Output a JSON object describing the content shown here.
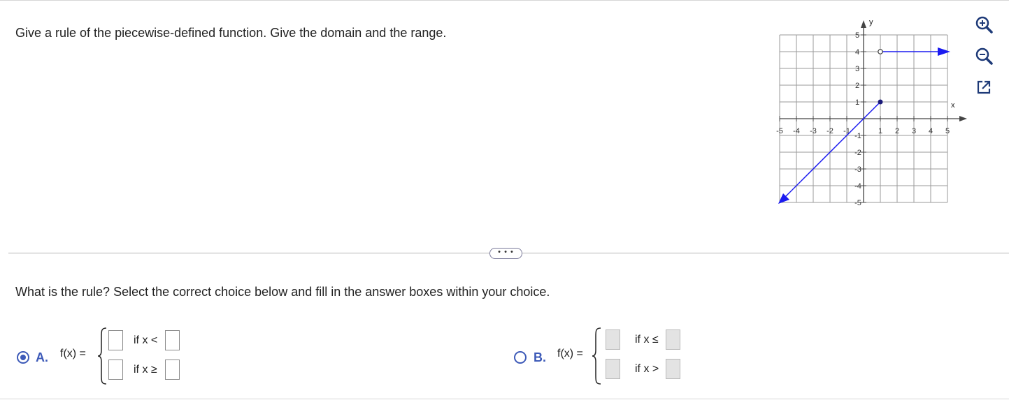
{
  "question": "Give a rule of the piecewise-defined function. Give the domain and the range.",
  "graph": {
    "x_label": "x",
    "y_label": "y",
    "x_ticks": [
      "-5",
      "-4",
      "-3",
      "-2",
      "-1",
      "1",
      "2",
      "3",
      "4",
      "5"
    ],
    "y_ticks_pos": [
      "5",
      "4",
      "3",
      "2",
      "1"
    ],
    "y_ticks_neg": [
      "-1",
      "-2",
      "-3",
      "-4",
      "-5"
    ],
    "line_color": "#1b1bf0",
    "segments": [
      {
        "from": [
          -5,
          -5
        ],
        "to": [
          1,
          1
        ],
        "arrow_at_start": true,
        "end": "closed"
      },
      {
        "from": [
          1,
          4
        ],
        "to": [
          5,
          4
        ],
        "start": "open",
        "arrow_at_end": true
      }
    ]
  },
  "tools": [
    "zoom-in-icon",
    "zoom-out-icon",
    "pop-out-icon"
  ],
  "more_button": "• • •",
  "prompt": "What is the rule? Select the correct choice below and fill in the answer boxes within your choice.",
  "choices": {
    "a": {
      "letter": "A.",
      "fx": "f(x) =",
      "cond1": "if x <",
      "cond2": "if x ≥",
      "selected": true
    },
    "b": {
      "letter": "B.",
      "fx": "f(x) =",
      "cond1": "if x ≤",
      "cond2": "if x >",
      "selected": false
    }
  }
}
